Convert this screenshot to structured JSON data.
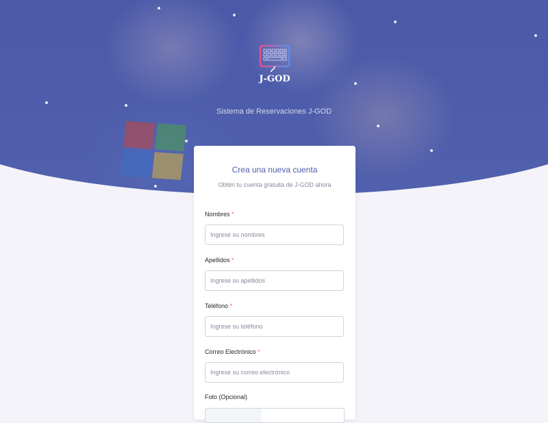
{
  "app": {
    "logo_text": "J-GOD",
    "subtitle": "Sistema de Reservaciones J-GOD"
  },
  "form": {
    "title": "Crea una nueva cuenta",
    "subtitle": "Obtén tu cuenta gratuita de J-GOD ahora",
    "required_mark": "*",
    "fields": [
      {
        "label": "Nombres",
        "placeholder": "Ingrese su nombres"
      },
      {
        "label": "Apellidos",
        "placeholder": "Ingrese su apellidos"
      },
      {
        "label": "Teléfono",
        "placeholder": "Ingrese su teléfono"
      },
      {
        "label": "Correo Electrónico",
        "placeholder": "Ingrese su correo electrónico"
      }
    ],
    "photo_label": "Foto (Opcional)"
  },
  "colors": {
    "primary": "#4c5ca9",
    "hero": "#4a5aa8",
    "required": "#f06548",
    "background": "#f3f3f9"
  },
  "icons": [
    "keyboard-logo-icon"
  ]
}
